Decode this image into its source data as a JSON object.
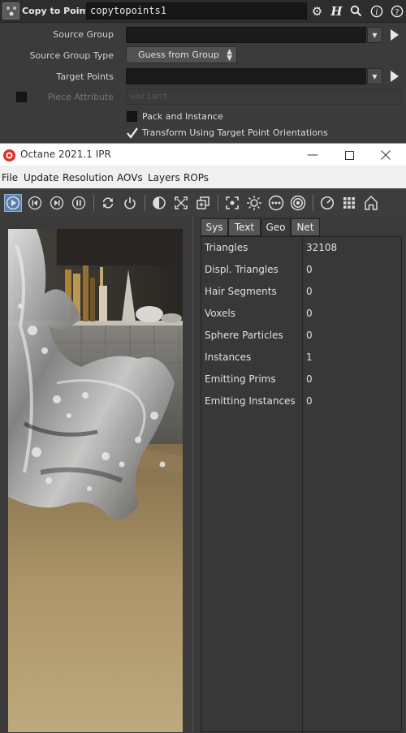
{
  "houdini": {
    "node_type": "Copy to Points",
    "node_name": "copytopoints1",
    "params": {
      "source_group_label": "Source Group",
      "source_group_type_label": "Source Group Type",
      "source_group_type_value": "Guess from Group",
      "target_points_label": "Target Points",
      "piece_attribute_label": "Piece Attribute",
      "piece_attribute_value": "variant",
      "pack_instance_label": "Pack and Instance",
      "transform_label": "Transform Using Target Point Orientations"
    },
    "header_icons": [
      "gear-icon",
      "help-h-icon",
      "search-icon",
      "info-icon",
      "help-icon"
    ]
  },
  "octane": {
    "title": "Octane 2021.1 IPR",
    "menu": [
      "File",
      "Update",
      "Resolution",
      "AOVs",
      "Layers",
      "ROPs"
    ],
    "toolbar_icons": [
      "render-start-icon",
      "skip-back-icon",
      "skip-forward-icon",
      "pause-icon",
      "restart-icon",
      "power-icon",
      "contrast-icon",
      "fit-view-icon",
      "region-icon",
      "focus-icon",
      "sun-icon",
      "more-icon",
      "target-icon",
      "clock-icon",
      "grid-icon",
      "home-icon"
    ],
    "tabs": [
      "Sys",
      "Text",
      "Geo",
      "Net"
    ],
    "active_tab": "Geo",
    "stats": [
      {
        "name": "Triangles",
        "value": "32108"
      },
      {
        "name": "Displ. Triangles",
        "value": "0"
      },
      {
        "name": "Hair Segments",
        "value": "0"
      },
      {
        "name": "Voxels",
        "value": "0"
      },
      {
        "name": "Sphere Particles",
        "value": "0"
      },
      {
        "name": "Instances",
        "value": "1"
      },
      {
        "name": "Emitting Prims",
        "value": "0"
      },
      {
        "name": "Emitting Instances",
        "value": "0"
      }
    ]
  }
}
